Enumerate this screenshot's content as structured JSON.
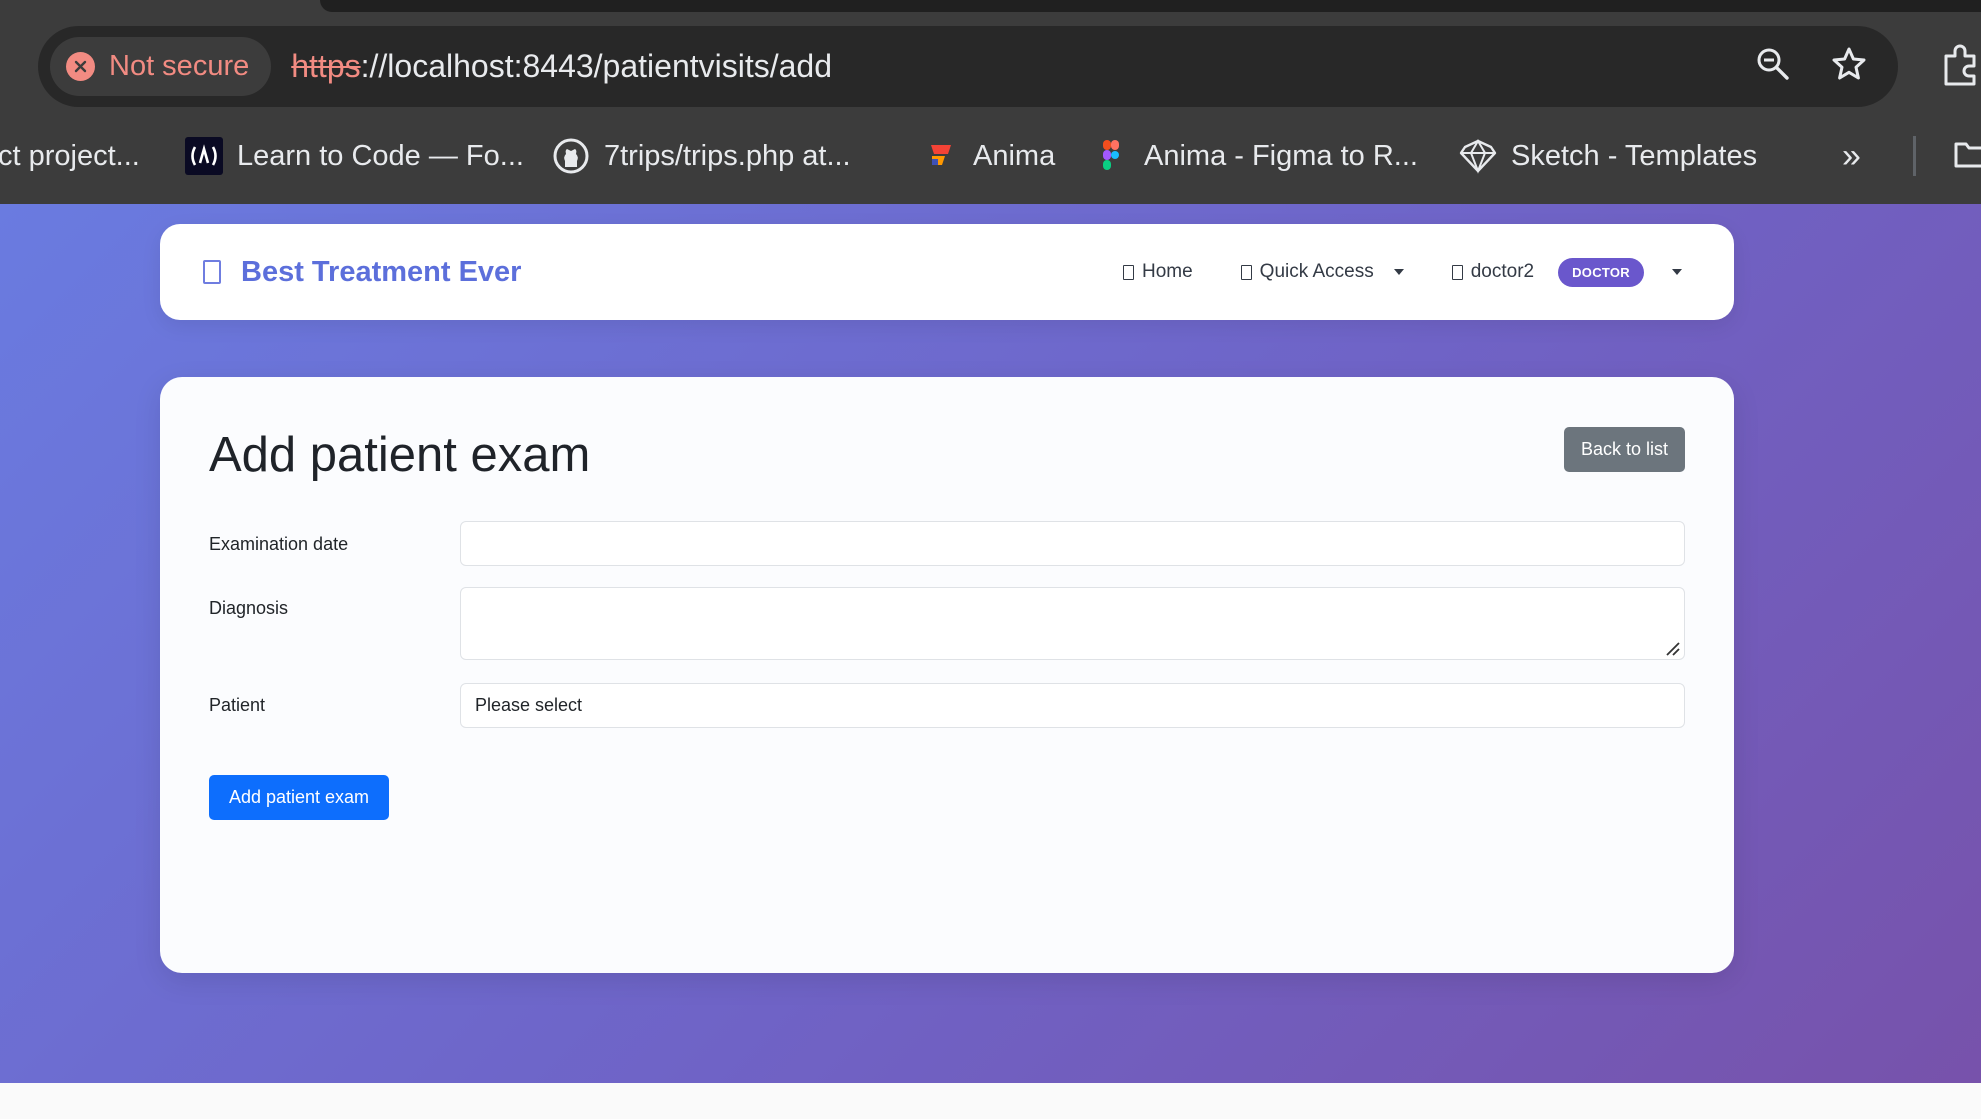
{
  "browser": {
    "security_label": "Not secure",
    "url_scheme": "https",
    "url_rest": "://localhost:8443/patientvisits/add",
    "bookmarks": [
      {
        "label": "ct project...",
        "icon": "page-icon"
      },
      {
        "label": "Learn to Code — Fo...",
        "icon": "freecodecamp-icon"
      },
      {
        "label": "7trips/trips.php at...",
        "icon": "github-icon"
      },
      {
        "label": "Anima",
        "icon": "anima-icon"
      },
      {
        "label": "Anima - Figma to R...",
        "icon": "figma-icon"
      },
      {
        "label": "Sketch - Templates",
        "icon": "sketch-icon"
      }
    ],
    "more_bookmarks": "»"
  },
  "navbar": {
    "brand": "Best Treatment Ever",
    "home": "Home",
    "quick_access": "Quick Access",
    "user": "doctor2",
    "role": "DOCTOR"
  },
  "form": {
    "title": "Add patient exam",
    "back_button": "Back to list",
    "examination_date_label": "Examination date",
    "examination_date_value": "",
    "diagnosis_label": "Diagnosis",
    "diagnosis_value": "",
    "patient_label": "Patient",
    "patient_selected": "Please select",
    "submit": "Add patient exam"
  },
  "colors": {
    "brand": "#5c6fdb",
    "role_badge": "#6a57cc",
    "primary_button": "#0d6efd",
    "secondary_button": "#6c757d",
    "insecure": "#f28b82"
  }
}
